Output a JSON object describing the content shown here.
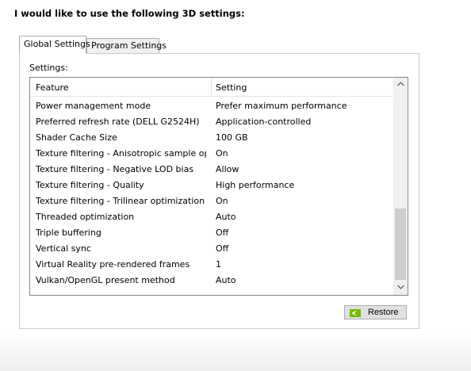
{
  "heading": "I would like to use the following 3D settings:",
  "tabs": [
    {
      "label": "Global Settings",
      "active": true
    },
    {
      "label": "Program Settings",
      "active": false
    }
  ],
  "settings_label": "Settings:",
  "columns": {
    "feature": "Feature",
    "setting": "Setting"
  },
  "rows": [
    {
      "feature": "Power management mode",
      "setting": "Prefer maximum performance"
    },
    {
      "feature": "Preferred refresh rate (DELL G2524H)",
      "setting": "Application-controlled"
    },
    {
      "feature": "Shader Cache Size",
      "setting": "100 GB"
    },
    {
      "feature": "Texture filtering - Anisotropic sample opti...",
      "setting": "On"
    },
    {
      "feature": "Texture filtering - Negative LOD bias",
      "setting": "Allow"
    },
    {
      "feature": "Texture filtering - Quality",
      "setting": "High performance"
    },
    {
      "feature": "Texture filtering - Trilinear optimization",
      "setting": "On"
    },
    {
      "feature": "Threaded optimization",
      "setting": "Auto"
    },
    {
      "feature": "Triple buffering",
      "setting": "Off"
    },
    {
      "feature": "Vertical sync",
      "setting": "Off"
    },
    {
      "feature": "Virtual Reality pre-rendered frames",
      "setting": "1"
    },
    {
      "feature": "Vulkan/OpenGL present method",
      "setting": "Auto"
    }
  ],
  "scrollbar": {
    "up_icon": "chevron-up-icon",
    "down_icon": "chevron-down-icon",
    "position_fraction": 0.85
  },
  "restore_button": {
    "label": "Restore",
    "icon": "nvidia-logo-icon"
  },
  "colors": {
    "nvidia_green": "#76b900"
  }
}
